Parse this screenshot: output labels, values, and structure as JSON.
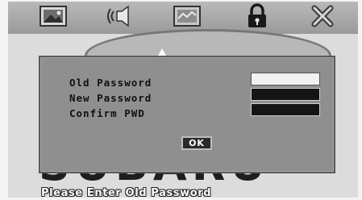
{
  "menu": {
    "icons": [
      {
        "name": "picture-icon"
      },
      {
        "name": "speaker-icon"
      },
      {
        "name": "display-icon"
      },
      {
        "name": "lock-icon"
      },
      {
        "name": "close-icon"
      }
    ]
  },
  "background": {
    "logo_text": "SUBARU"
  },
  "dialog": {
    "old_password_label": "Old Password",
    "new_password_label": "New Password",
    "confirm_label": "Confirm PWD",
    "ok_label": "OK"
  },
  "status": {
    "message": "Please Enter Old Password"
  },
  "colors": {
    "field_active": "#f2f2f2",
    "field_idle": "#151515",
    "dialog_bg": "#8f8f8f"
  }
}
